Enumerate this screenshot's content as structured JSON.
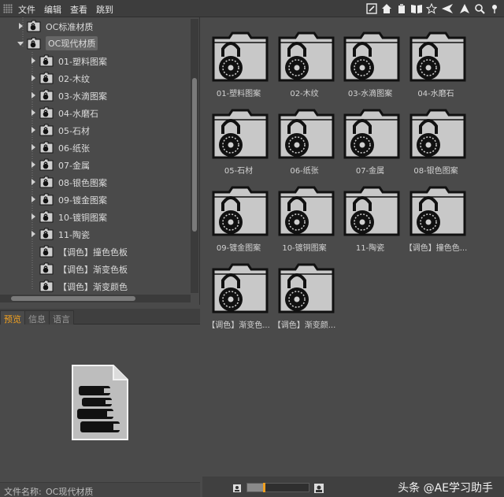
{
  "menubar": {
    "items": [
      "文件",
      "编辑",
      "查看",
      "跳到"
    ]
  },
  "toolbar": {
    "icons": [
      "edit-icon",
      "home-icon",
      "clipboard-icon",
      "book-icon",
      "star-icon",
      "back-arrow-icon",
      "up-arrow-icon",
      "search-icon",
      "pin-icon"
    ]
  },
  "tree": {
    "items": [
      {
        "label": "OC标准材质",
        "level": 1,
        "expanded": false,
        "selected": false
      },
      {
        "label": "OC现代材质",
        "level": 1,
        "expanded": true,
        "selected": true
      },
      {
        "label": "01-塑料图案",
        "level": 2,
        "expanded": false,
        "selected": false
      },
      {
        "label": "02-木纹",
        "level": 2,
        "expanded": false,
        "selected": false
      },
      {
        "label": "03-水滴图案",
        "level": 2,
        "expanded": false,
        "selected": false
      },
      {
        "label": "04-水磨石",
        "level": 2,
        "expanded": false,
        "selected": false
      },
      {
        "label": "05-石材",
        "level": 2,
        "expanded": false,
        "selected": false
      },
      {
        "label": "06-纸张",
        "level": 2,
        "expanded": false,
        "selected": false
      },
      {
        "label": "07-金属",
        "level": 2,
        "expanded": false,
        "selected": false
      },
      {
        "label": "08-银色图案",
        "level": 2,
        "expanded": false,
        "selected": false
      },
      {
        "label": "09-镀金图案",
        "level": 2,
        "expanded": false,
        "selected": false
      },
      {
        "label": "10-镀铜图案",
        "level": 2,
        "expanded": false,
        "selected": false
      },
      {
        "label": "11-陶瓷",
        "level": 2,
        "expanded": false,
        "selected": false
      },
      {
        "label": "【调色】撞色色板",
        "level": 2,
        "leaf": true,
        "selected": false
      },
      {
        "label": "【调色】渐变色板",
        "level": 2,
        "leaf": true,
        "selected": false
      },
      {
        "label": "【调色】渐变颜色",
        "level": 2,
        "leaf": true,
        "selected": false
      }
    ]
  },
  "tabs": {
    "items": [
      "预览",
      "信息",
      "语言"
    ],
    "active": "预览"
  },
  "status": {
    "filename_label": "文件名称:",
    "filename_value": "OC现代材质"
  },
  "grid": {
    "items": [
      "01-塑料图案",
      "02-木纹",
      "03-水滴图案",
      "04-水磨石",
      "05-石材",
      "06-纸张",
      "07-金属",
      "08-银色图案",
      "09-镀金图案",
      "10-镀铜图案",
      "11-陶瓷",
      "【调色】撞色色...",
      "【调色】渐变色...",
      "【调色】渐变颜..."
    ]
  },
  "zoom": {
    "level": 0.25
  },
  "watermark": {
    "text": "头条 @AE学习助手"
  },
  "colors": {
    "accent": "#f0a020",
    "background": "#4a4a4a",
    "menubar": "#3d3d3d"
  }
}
